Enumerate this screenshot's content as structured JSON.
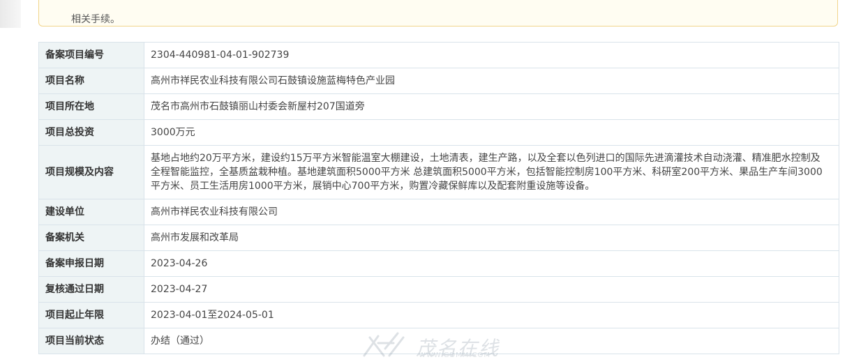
{
  "notice": {
    "line2": "相关手续。"
  },
  "record": {
    "rows": [
      {
        "label": "备案项目编号",
        "value": "2304-440981-04-01-902739"
      },
      {
        "label": "项目名称",
        "value": "高州市祥民农业科技有限公司石鼓镇设施蓝梅特色产业园"
      },
      {
        "label": "项目所在地",
        "value": "茂名市高州市石鼓镇丽山村委会新屋村207国道旁"
      },
      {
        "label": "项目总投资",
        "value": "3000万元"
      },
      {
        "label": "项目规模及内容",
        "value": "基地占地约20万平方米，建设约15万平方米智能温室大棚建设，土地清表，建生产路，以及全套以色列进口的国际先进滴灌技术自动浇灌、精准肥水控制及全程智能监控，全基质盆栽种植。基地建筑面积5000平方米 总建筑面积5000平方米，包括智能控制房100平方米、科研室200平方米、果品生产车间3000平方米、员工生活用房1000平方米，展销中心700平方米，购置冷藏保鲜库以及配套附重设施等设备。"
      },
      {
        "label": "建设单位",
        "value": "高州市祥民农业科技有限公司"
      },
      {
        "label": "备案机关",
        "value": "高州市发展和改革局"
      },
      {
        "label": "备案申报日期",
        "value": "2023-04-26"
      },
      {
        "label": "复核通过日期",
        "value": "2023-04-27"
      },
      {
        "label": "项目起止年限",
        "value": "2023-04-01至2024-05-01"
      },
      {
        "label": "项目当前状态",
        "value": "办结（通过）"
      }
    ]
  },
  "watermark": {
    "text": "茂名在线",
    "url": "WWW.GDMM.COM"
  },
  "colors": {
    "label_bg": "#eef4f5",
    "border": "#d9e3ea",
    "notice_border": "#f1d58a",
    "notice_bg": "#fffdf2"
  }
}
